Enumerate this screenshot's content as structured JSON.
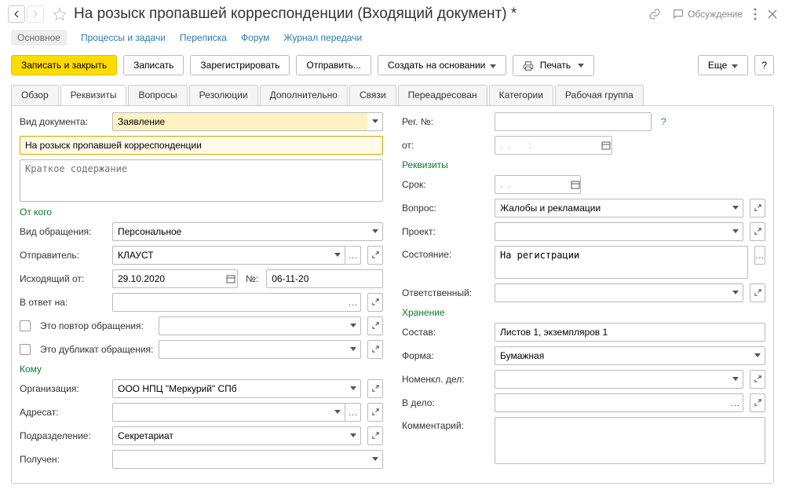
{
  "title": "На розыск пропавшей корреспонденции (Входящий документ) *",
  "title_actions": {
    "discuss": "Обсуждение"
  },
  "subnav": {
    "main": "Основное",
    "processes": "Процессы и задачи",
    "mail": "Переписка",
    "forum": "Форум",
    "journal": "Журнал передачи"
  },
  "toolbar": {
    "save_close": "Записать и закрыть",
    "save": "Записать",
    "register": "Зарегистрировать",
    "send": "Отправить...",
    "create_based": "Создать на основании",
    "print": "Печать",
    "more": "Еще",
    "help": "?"
  },
  "tabs": {
    "overview": "Обзор",
    "requisites": "Реквизиты",
    "questions": "Вопросы",
    "resolutions": "Резолюции",
    "additional": "Дополнительно",
    "links": "Связи",
    "readdressed": "Переадресован",
    "categories": "Категории",
    "workgroup": "Рабочая группа"
  },
  "left": {
    "doc_type_label": "Вид документа:",
    "doc_type_value": "Заявление",
    "subject_value": "На розыск пропавшей корреспонденции",
    "desc_placeholder": "Краткое содержание",
    "from_header": "От кого",
    "appeal_type_label": "Вид обращения:",
    "appeal_type_value": "Персональное",
    "sender_label": "Отправитель:",
    "sender_value": "КЛАУСТ",
    "outgoing_from_label": "Исходящий от:",
    "outgoing_date": "29.10.2020",
    "out_no_label": "№:",
    "out_no_value": "06-11-20",
    "reply_to_label": "В ответ на:",
    "repeat_label": "Это повтор обращения:",
    "dup_label": "Это дубликат обращения:",
    "to_header": "Кому",
    "org_label": "Организация:",
    "org_value": "ООО НПЦ \"Меркурий\" СПб",
    "addressee_label": "Адресат:",
    "department_label": "Подразделение:",
    "department_value": "Секретариат",
    "received_label": "Получен:"
  },
  "right": {
    "reg_no_label": "Рег. №:",
    "from_date_label": "от:",
    "from_date_placeholder": ".  .       :",
    "req_header": "Реквизиты",
    "deadline_label": "Срок:",
    "deadline_placeholder": ".  .",
    "question_label": "Вопрос:",
    "question_value": "Жалобы и рекламации",
    "project_label": "Проект:",
    "state_label": "Состояние:",
    "state_value": "На регистрации",
    "responsible_label": "Ответственный:",
    "storage_header": "Хранение",
    "composition_label": "Состав:",
    "composition_value": "Листов 1, экземпляров 1",
    "form_label": "Форма:",
    "form_value": "Бумажная",
    "nomencl_label": "Номенкл. дел:",
    "to_case_label": "В дело:",
    "comment_label": "Комментарий:"
  }
}
